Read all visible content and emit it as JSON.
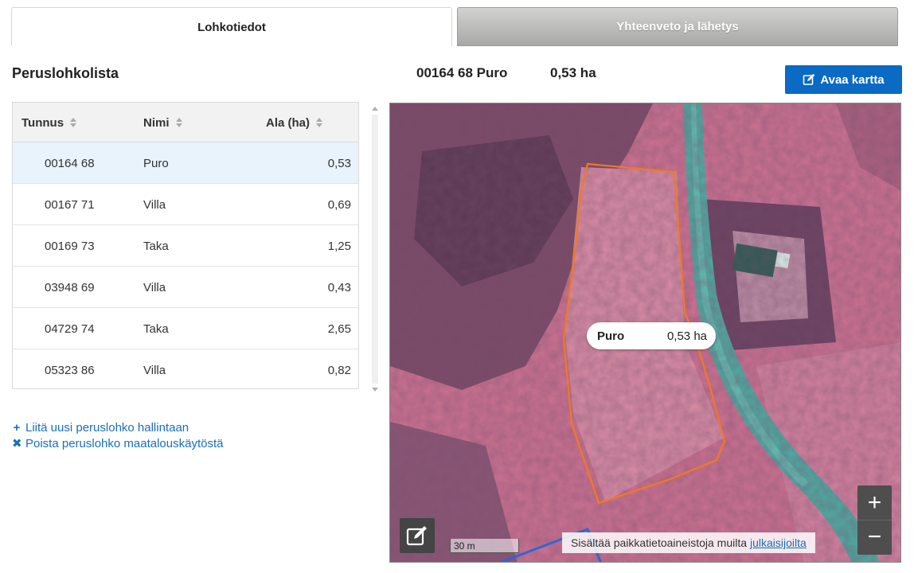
{
  "tabs": [
    {
      "label": "Lohkotiedot",
      "active": true
    },
    {
      "label": "Yhteenveto ja lähetys",
      "active": false
    }
  ],
  "list_title": "Peruslohkolista",
  "selected": {
    "id": "00164 68 Puro",
    "area": "0,53 ha"
  },
  "open_map_label": "Avaa kartta",
  "table": {
    "headers": [
      "Tunnus",
      "Nimi",
      "Ala (ha)"
    ],
    "rows": [
      {
        "id": "00164 68",
        "name": "Puro",
        "area": "0,53"
      },
      {
        "id": "00167 71",
        "name": "Villa",
        "area": "0,69"
      },
      {
        "id": "00169 73",
        "name": "Taka",
        "area": "1,25"
      },
      {
        "id": "03948 69",
        "name": "Villa",
        "area": "0,43"
      },
      {
        "id": "04729 74",
        "name": "Taka",
        "area": "2,65"
      },
      {
        "id": "05323 86",
        "name": "Villa",
        "area": "0,82"
      }
    ]
  },
  "actions": {
    "add": "Liitä uusi peruslohko hallintaan",
    "remove": "Poista peruslohko maatalouskäytöstä"
  },
  "map": {
    "popup_name": "Puro",
    "popup_area": "0,53 ha",
    "scale_label": "30 m",
    "attribution_text": "Sisältää paikkatietoaineistoja muilta",
    "attribution_link": "julkaisijoilta",
    "zoom_in": "+",
    "zoom_out": "−"
  },
  "colors": {
    "accent": "#0a6ac4",
    "link": "#1a6fb8",
    "selected_row": "#e8f3fb",
    "parcel_outline": "#f07a1e"
  }
}
